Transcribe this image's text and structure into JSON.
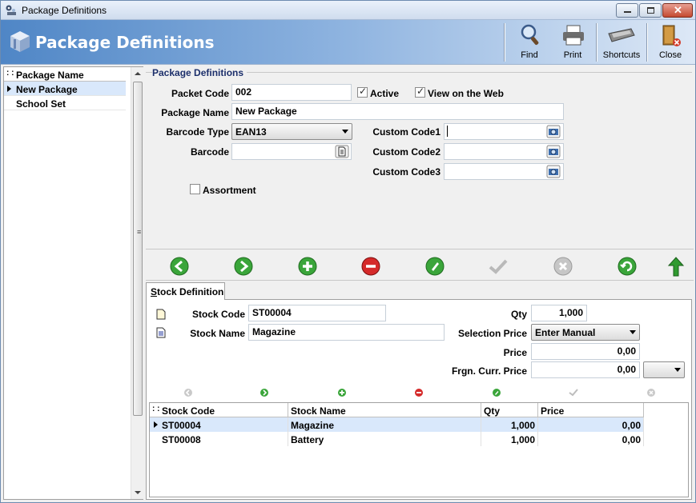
{
  "window": {
    "title": "Package Definitions"
  },
  "header": {
    "title": "Package Definitions"
  },
  "toolbar": {
    "find_label": "Find",
    "print_label": "Print",
    "shortcuts_label": "Shortcuts",
    "close_label": "Close"
  },
  "left_list": {
    "header": "Package Name",
    "items": [
      {
        "label": "New Package",
        "selected": true
      },
      {
        "label": "School Set",
        "selected": false
      }
    ]
  },
  "form": {
    "section_title": "Package Definitions",
    "packet_code_label": "Packet Code",
    "packet_code_value": "002",
    "active_label": "Active",
    "active_checked": true,
    "view_on_web_label": "View on the Web",
    "view_on_web_checked": true,
    "package_name_label": "Package Name",
    "package_name_value": "New Package",
    "barcode_type_label": "Barcode Type",
    "barcode_type_value": "EAN13",
    "barcode_label": "Barcode",
    "barcode_value": "",
    "custom_code1_label": "Custom Code1",
    "custom_code1_value": "",
    "custom_code2_label": "Custom Code2",
    "custom_code2_value": "",
    "custom_code3_label": "Custom Code3",
    "custom_code3_value": "",
    "assortment_label": "Assortment",
    "assortment_checked": false
  },
  "nav_icons": [
    "prev-icon",
    "next-icon",
    "add-icon",
    "remove-icon",
    "edit-icon",
    "confirm-icon",
    "cancel-icon",
    "refresh-icon",
    "up-arrow-icon"
  ],
  "stock_tab": {
    "tab_label_underlined": "S",
    "tab_label_rest": "tock Definition",
    "stock_code_label": "Stock Code",
    "stock_code_value": "ST00004",
    "stock_name_label": "Stock Name",
    "stock_name_value": "Magazine",
    "qty_label": "Qty",
    "qty_value": "1,000",
    "selection_price_label": "Selection Price",
    "selection_price_value": "Enter Manual",
    "price_label": "Price",
    "price_value": "0,00",
    "frgn_price_label": "Frgn. Curr. Price",
    "frgn_price_value": "0,00",
    "currency_value": ""
  },
  "stock_grid": {
    "columns": [
      "Stock Code",
      "Stock Name",
      "Qty",
      "Price"
    ],
    "rows": [
      {
        "code": "ST00004",
        "name": "Magazine",
        "qty": "1,000",
        "price": "0,00",
        "selected": true
      },
      {
        "code": "ST00008",
        "name": "Battery",
        "qty": "1,000",
        "price": "0,00",
        "selected": false
      }
    ]
  },
  "colors": {
    "header_gradient_start": "#4f86c6",
    "selection": "#d9e8fb",
    "section_title": "#1c2f6b"
  }
}
